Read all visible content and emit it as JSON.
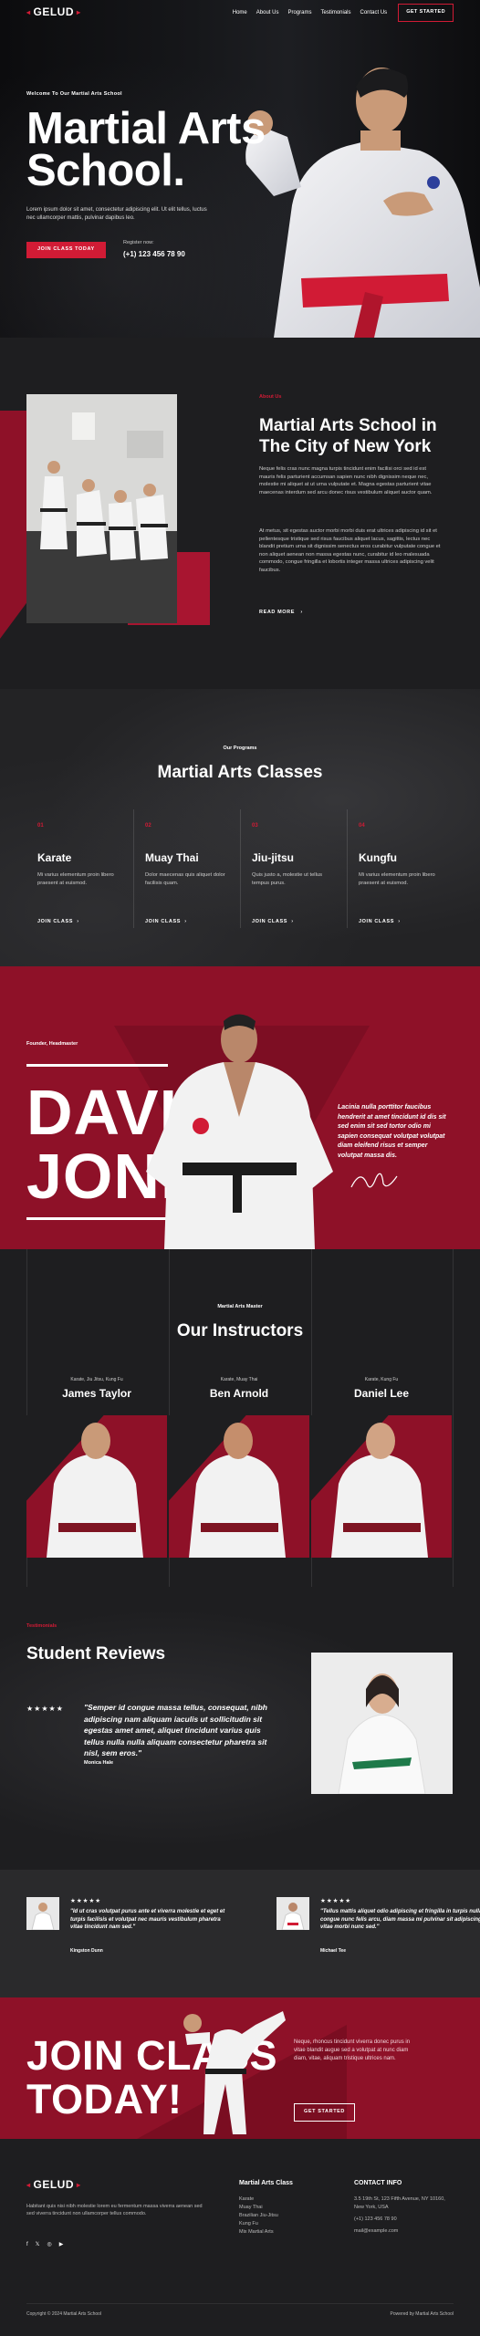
{
  "nav": {
    "logo": "GELUD",
    "links": [
      "Home",
      "About Us",
      "Programs",
      "Testimonials",
      "Contact Us"
    ],
    "cta": "GET STARTED"
  },
  "hero": {
    "kicker": "Welcome To Our Martial Arts School",
    "title_line1": "Martial Arts",
    "title_line2": "School.",
    "text": "Lorem ipsum dolor sit amet, consectetur adipiscing elit. Ut elit tellus, luctus nec ullamcorper mattis, pulvinar dapibus leo.",
    "button": "JOIN CLASS TODAY",
    "register_label": "Register now:",
    "phone": "(+1) 123 456 78 90"
  },
  "about": {
    "kicker": "About Us",
    "title": "Martial Arts School in The City of New York",
    "p1": "Neque felis cras nunc magna turpis tincidunt enim facilisi orci sed id est mauris felis parturient accumsan sapien nunc nibh dignissim neque nec, molestie mi aliquet at ut urna vulputate et. Magna egestas parturient vitae maecenas interdum sed arcu donec risus vestibulum aliquet auctor quam.",
    "p2": "At metus, sit egestas auctor morbi morbi duis erat ultrices adipiscing id sit et pellentesque tristique sed risus faucibus aliquet lacus, sagittis, lectus nec blandit pretium urna sit dignissim senectus eros curabitur vulputate congue et non aliquet aenean non massa egestas nunc, curabitur id leo malesuada commodo, congue fringilla et lobortis integer massa ultrices adipiscing velit faucibus.",
    "more": "READ MORE"
  },
  "classes": {
    "kicker": "Our Programs",
    "title": "Martial Arts Classes",
    "items": [
      {
        "num": "01",
        "name": "Karate",
        "desc": "Mi varius elementum proin libero praesent at euismod.",
        "link": "JOIN CLASS"
      },
      {
        "num": "02",
        "name": "Muay Thai",
        "desc": "Dolor maecenas quis aliquet dolor facilisis quam.",
        "link": "JOIN CLASS"
      },
      {
        "num": "03",
        "name": "Jiu-jitsu",
        "desc": "Quis justo a, molestie ut tellus tempus purus.",
        "link": "JOIN CLASS"
      },
      {
        "num": "04",
        "name": "Kungfu",
        "desc": "Mi varius elementum proin libero praesent at euismod.",
        "link": "JOIN CLASS"
      }
    ]
  },
  "founder": {
    "kicker": "Founder, Headmaster",
    "first": "DAVID",
    "last": "JONES",
    "quote": "Lacinia nulla porttitor faucibus hendrerit at amet tincidunt id dis sit sed enim sit sed tortor odio mi sapien consequat volutpat volutpat diam eleifend risus et semper volutpat massa dis."
  },
  "instructors": {
    "kicker": "Martial Arts Master",
    "title": "Our Instructors",
    "items": [
      {
        "tags": "Karate, Jiu Jitsu, Kung Fu",
        "name": "James Taylor"
      },
      {
        "tags": "Karate, Muay Thai",
        "name": "Ben Arnold"
      },
      {
        "tags": "Karate, Kung Fu",
        "name": "Daniel Lee"
      }
    ]
  },
  "reviews": {
    "kicker": "Testimonials",
    "title": "Student Reviews",
    "stars": "★★★★★",
    "quote": "\"Semper id congue massa tellus, consequat, nibh adipiscing nam aliquam iaculis ut sollicitudin sit egestas amet amet, aliquet tincidunt varius quis tellus nulla nulla aliquam consectetur pharetra sit nisl, sem eros.\"",
    "author": "Monica Hale"
  },
  "strip": [
    {
      "stars": "★★★★★",
      "quote": "\"Id ut cras volutpat purus ante et viverra molestie et eget et turpis facilisis et volutpat nec mauris vestibulum pharetra vitae tincidunt nam sed.\"",
      "author": "Kingston Dunn"
    },
    {
      "stars": "★★★★★",
      "quote": "\"Tellus mattis aliquet odio adipiscing et fringilla in turpis nulla congue nunc felis arcu, diam massa mi pulvinar sit adipiscing vitae morbi nunc sed.\"",
      "author": "Michael Tee"
    }
  ],
  "join": {
    "line1": "JOIN CLASS",
    "line2": "TODAY!",
    "text": "Neque, rhoncus tincidunt viverra donec purus in vitae blandit augue sed a volutpat at nunc diam diam, vitae, aliquam tristique ultrices nam.",
    "button": "GET STARTED"
  },
  "footer": {
    "logo": "GELUD",
    "text": "Habitant quis nisi nibh molestie lorem eu fermentum massa viverra aenean sed sed viverra tincidunt non ullamcorper tellus commodo.",
    "classes_title": "Martial Arts Class",
    "classes": [
      "Karate",
      "Muay Thai",
      "Brazilian Jiu-Jitsu",
      "Kung Fu",
      "Mix Martial Arts"
    ],
    "contact_title": "CONTACT INFO",
    "contact": [
      "3.5 19th St, 123 Fifth Avenue, NY 10160, New York, USA",
      "(+1) 123 456 78 90",
      "mail@example.com"
    ],
    "copyright": "Copyright © 2024 Martial Arts School",
    "powered": "Powered by Martial Arts School"
  },
  "colors": {
    "accent": "#d11b35",
    "maroon": "#8e1128",
    "dark": "#1e1e20"
  }
}
